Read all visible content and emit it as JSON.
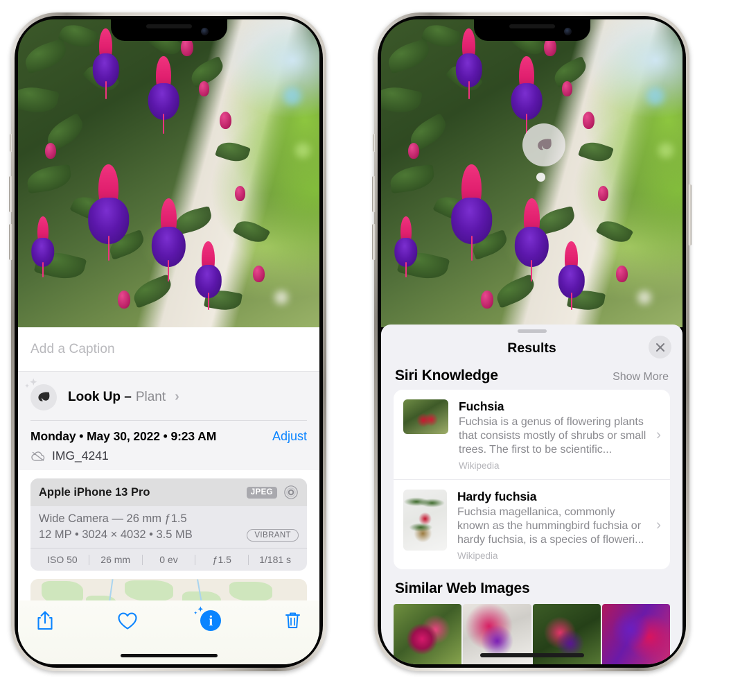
{
  "left_phone": {
    "photo": {
      "alt_name": "fuchsia-flowers-photo"
    },
    "caption_field": {
      "placeholder": "Add a Caption",
      "value": ""
    },
    "lookup": {
      "icon": "leaf-icon",
      "sparkle_icon": "sparkle-icon",
      "label": "Look Up –",
      "subject": "Plant",
      "chevron": "›"
    },
    "details": {
      "date_line": "Monday • May 30, 2022 • 9:23 AM",
      "adjust_label": "Adjust",
      "cloud_icon": "cloud-slash-icon",
      "file_name": "IMG_4241"
    },
    "camera_card": {
      "model": "Apple iPhone 13 Pro",
      "format_badge": "JPEG",
      "aperture_icon": "aperture-icon",
      "lens_line": "Wide Camera — 26 mm ƒ1.5",
      "size_line": "12 MP • 3024 × 4032 • 3.5 MB",
      "style_badge": "VIBRANT",
      "exif": [
        "ISO 50",
        "26 mm",
        "0 ev",
        "ƒ1.5",
        "1/181 s"
      ]
    },
    "map": {
      "name": "location-map",
      "pin": "photo-pin"
    },
    "toolbar": [
      {
        "name": "share-button",
        "icon": "share-icon"
      },
      {
        "name": "favorite-button",
        "icon": "heart-icon"
      },
      {
        "name": "info-button",
        "icon": "info-sparkle-icon"
      },
      {
        "name": "delete-button",
        "icon": "trash-icon"
      }
    ]
  },
  "right_phone": {
    "visual_look_up_bubble": {
      "icon": "leaf-icon"
    },
    "sheet": {
      "grabber": "sheet-grabber",
      "title": "Results",
      "close_icon": "close-icon",
      "sections": [
        {
          "title": "Siri Knowledge",
          "action_label": "Show More",
          "items": [
            {
              "title": "Fuchsia",
              "description": "Fuchsia is a genus of flowering plants that consists mostly of shrubs or small trees. The first to be scientific...",
              "source": "Wikipedia",
              "thumb": "fuchsia-red-flowers-thumbnail",
              "chevron": "›"
            },
            {
              "title": "Hardy fuchsia",
              "description": "Fuchsia magellanica, commonly known as the hummingbird fuchsia or hardy fuchsia, is a species of floweri...",
              "source": "Wikipedia",
              "thumb": "hardy-fuchsia-branch-thumbnail",
              "chevron": "›"
            }
          ]
        },
        {
          "title": "Similar Web Images",
          "thumbnails": [
            "similar-image-1",
            "similar-image-2",
            "similar-image-3",
            "similar-image-4"
          ]
        }
      ]
    }
  },
  "colors": {
    "accent_blue": "#0a84ff",
    "sheet_bg": "#f1f1f5",
    "card_bg": "#ffffff",
    "secondary_text": "#8a8a8f",
    "meta_card_bg": "#e9e9ed"
  }
}
